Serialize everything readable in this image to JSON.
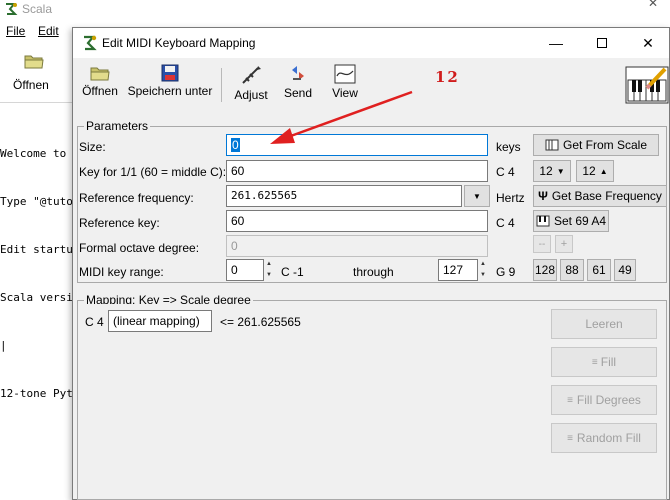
{
  "background_app": {
    "title": "Scala",
    "menus": [
      "File",
      "Edit"
    ],
    "toolbar": [
      {
        "label": "Öffnen",
        "icon": "folder-icon"
      }
    ],
    "console_lines": [
      "Welcome to",
      "Type \"@tuto",
      "Edit startu",
      "Scala versi",
      "|",
      "12-tone Pyt"
    ]
  },
  "dialog": {
    "title": "Edit MIDI Keyboard Mapping",
    "toolbar": [
      {
        "label": "Öffnen",
        "icon": "folder-icon"
      },
      {
        "label": "Speichern unter",
        "icon": "save-icon"
      },
      {
        "label": "Adjust",
        "icon": "adjust-icon"
      },
      {
        "label": "Send",
        "icon": "send-icon"
      },
      {
        "label": "View",
        "icon": "view-icon"
      }
    ],
    "annotation": "12",
    "parameters": {
      "legend": "Parameters",
      "size": {
        "label": "Size:",
        "value": "0",
        "unit": "keys",
        "button": "Get From Scale"
      },
      "key_for_1_1": {
        "label": "Key for 1/1 (60 = middle C):",
        "value": "60",
        "note": "C 4",
        "dd1": "12",
        "dd2": "12"
      },
      "reference_frequency": {
        "label": "Reference frequency:",
        "value": "261.625565",
        "unit": "Hertz",
        "button": "Get Base Frequency"
      },
      "reference_key": {
        "label": "Reference key:",
        "value": "60",
        "note": "C 4",
        "button": "Set 69 A4"
      },
      "formal_octave_degree": {
        "label": "Formal octave degree:",
        "value": "0",
        "minus": "--",
        "plus": "+"
      },
      "midi_key_range": {
        "label": "MIDI key range:",
        "from_value": "0",
        "from_note": "C -1",
        "through_label": "through",
        "to_value": "127",
        "to_note": "G 9",
        "presets": [
          "128",
          "88",
          "61",
          "49"
        ]
      }
    },
    "mapping": {
      "legend": "Mapping: Key => Scale degree",
      "row_note": "C 4",
      "row_value": "(linear mapping)",
      "row_freq": "<= 261.625565",
      "buttons": [
        "Leeren",
        "Fill",
        "Fill Degrees",
        "Random Fill"
      ]
    }
  }
}
